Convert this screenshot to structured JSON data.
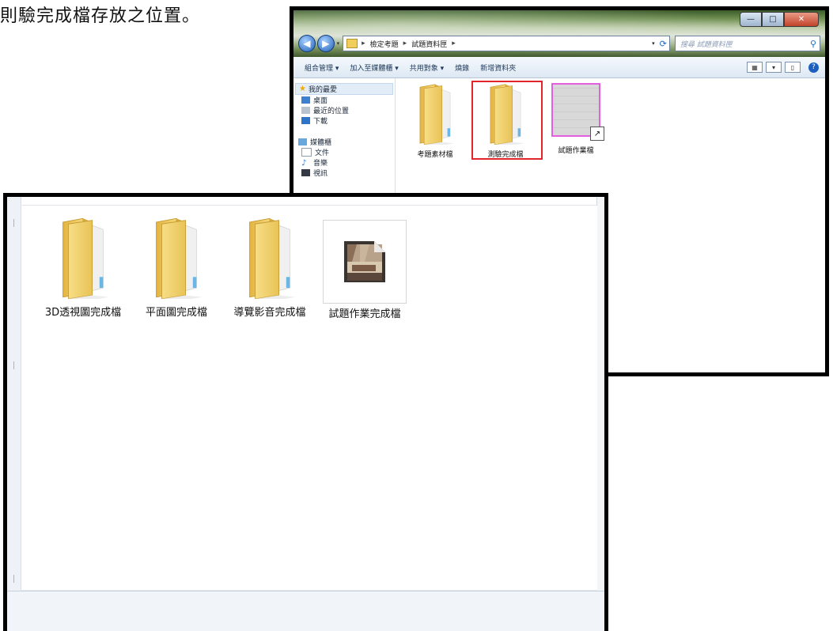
{
  "caption": "則驗完成檔存放之位置。",
  "back_window": {
    "controls": {
      "minimize": "—",
      "maximize": "□",
      "close": "✕"
    },
    "breadcrumb": [
      "檢定考題",
      "試題資料匣"
    ],
    "search_placeholder": "搜尋 試題資料匣",
    "toolbar": [
      "組合管理 ▾",
      "加入至媒體櫃 ▾",
      "共用對象 ▾",
      "燒錄",
      "新增資料夾"
    ],
    "sidebar": {
      "favorites_label": "我的最愛",
      "favorites": [
        "桌面",
        "最近的位置",
        "下載"
      ],
      "library_label": "媒體櫃",
      "libraries": [
        "文件",
        "音樂",
        "視訊"
      ]
    },
    "items": [
      {
        "label": "考題素材檔",
        "type": "folder"
      },
      {
        "label": "測驗完成檔",
        "type": "folder",
        "selected": true
      },
      {
        "label": "試題作業檔",
        "type": "file"
      }
    ]
  },
  "front_window": {
    "items": [
      {
        "label": "3D透視圖完成檔",
        "type": "folder"
      },
      {
        "label": "平面圖完成檔",
        "type": "folder"
      },
      {
        "label": "導覽影音完成檔",
        "type": "folder"
      },
      {
        "label": "試題作業完成檔",
        "type": "file"
      }
    ]
  },
  "colors": {
    "selection_box": "#e1252a",
    "thumb_border": "#e45fe0",
    "folder": "#f1cd5a"
  }
}
